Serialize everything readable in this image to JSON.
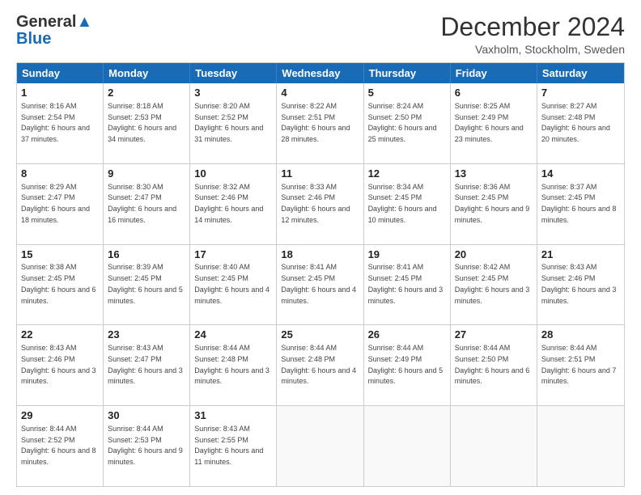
{
  "header": {
    "logo_line1": "General",
    "logo_line2": "Blue",
    "title": "December 2024",
    "subtitle": "Vaxholm, Stockholm, Sweden"
  },
  "days": [
    "Sunday",
    "Monday",
    "Tuesday",
    "Wednesday",
    "Thursday",
    "Friday",
    "Saturday"
  ],
  "weeks": [
    [
      {
        "day": "1",
        "sunrise": "8:16 AM",
        "sunset": "2:54 PM",
        "daylight": "6 hours and 37 minutes."
      },
      {
        "day": "2",
        "sunrise": "8:18 AM",
        "sunset": "2:53 PM",
        "daylight": "6 hours and 34 minutes."
      },
      {
        "day": "3",
        "sunrise": "8:20 AM",
        "sunset": "2:52 PM",
        "daylight": "6 hours and 31 minutes."
      },
      {
        "day": "4",
        "sunrise": "8:22 AM",
        "sunset": "2:51 PM",
        "daylight": "6 hours and 28 minutes."
      },
      {
        "day": "5",
        "sunrise": "8:24 AM",
        "sunset": "2:50 PM",
        "daylight": "6 hours and 25 minutes."
      },
      {
        "day": "6",
        "sunrise": "8:25 AM",
        "sunset": "2:49 PM",
        "daylight": "6 hours and 23 minutes."
      },
      {
        "day": "7",
        "sunrise": "8:27 AM",
        "sunset": "2:48 PM",
        "daylight": "6 hours and 20 minutes."
      }
    ],
    [
      {
        "day": "8",
        "sunrise": "8:29 AM",
        "sunset": "2:47 PM",
        "daylight": "6 hours and 18 minutes."
      },
      {
        "day": "9",
        "sunrise": "8:30 AM",
        "sunset": "2:47 PM",
        "daylight": "6 hours and 16 minutes."
      },
      {
        "day": "10",
        "sunrise": "8:32 AM",
        "sunset": "2:46 PM",
        "daylight": "6 hours and 14 minutes."
      },
      {
        "day": "11",
        "sunrise": "8:33 AM",
        "sunset": "2:46 PM",
        "daylight": "6 hours and 12 minutes."
      },
      {
        "day": "12",
        "sunrise": "8:34 AM",
        "sunset": "2:45 PM",
        "daylight": "6 hours and 10 minutes."
      },
      {
        "day": "13",
        "sunrise": "8:36 AM",
        "sunset": "2:45 PM",
        "daylight": "6 hours and 9 minutes."
      },
      {
        "day": "14",
        "sunrise": "8:37 AM",
        "sunset": "2:45 PM",
        "daylight": "6 hours and 8 minutes."
      }
    ],
    [
      {
        "day": "15",
        "sunrise": "8:38 AM",
        "sunset": "2:45 PM",
        "daylight": "6 hours and 6 minutes."
      },
      {
        "day": "16",
        "sunrise": "8:39 AM",
        "sunset": "2:45 PM",
        "daylight": "6 hours and 5 minutes."
      },
      {
        "day": "17",
        "sunrise": "8:40 AM",
        "sunset": "2:45 PM",
        "daylight": "6 hours and 4 minutes."
      },
      {
        "day": "18",
        "sunrise": "8:41 AM",
        "sunset": "2:45 PM",
        "daylight": "6 hours and 4 minutes."
      },
      {
        "day": "19",
        "sunrise": "8:41 AM",
        "sunset": "2:45 PM",
        "daylight": "6 hours and 3 minutes."
      },
      {
        "day": "20",
        "sunrise": "8:42 AM",
        "sunset": "2:45 PM",
        "daylight": "6 hours and 3 minutes."
      },
      {
        "day": "21",
        "sunrise": "8:43 AM",
        "sunset": "2:46 PM",
        "daylight": "6 hours and 3 minutes."
      }
    ],
    [
      {
        "day": "22",
        "sunrise": "8:43 AM",
        "sunset": "2:46 PM",
        "daylight": "6 hours and 3 minutes."
      },
      {
        "day": "23",
        "sunrise": "8:43 AM",
        "sunset": "2:47 PM",
        "daylight": "6 hours and 3 minutes."
      },
      {
        "day": "24",
        "sunrise": "8:44 AM",
        "sunset": "2:48 PM",
        "daylight": "6 hours and 3 minutes."
      },
      {
        "day": "25",
        "sunrise": "8:44 AM",
        "sunset": "2:48 PM",
        "daylight": "6 hours and 4 minutes."
      },
      {
        "day": "26",
        "sunrise": "8:44 AM",
        "sunset": "2:49 PM",
        "daylight": "6 hours and 5 minutes."
      },
      {
        "day": "27",
        "sunrise": "8:44 AM",
        "sunset": "2:50 PM",
        "daylight": "6 hours and 6 minutes."
      },
      {
        "day": "28",
        "sunrise": "8:44 AM",
        "sunset": "2:51 PM",
        "daylight": "6 hours and 7 minutes."
      }
    ],
    [
      {
        "day": "29",
        "sunrise": "8:44 AM",
        "sunset": "2:52 PM",
        "daylight": "6 hours and 8 minutes."
      },
      {
        "day": "30",
        "sunrise": "8:44 AM",
        "sunset": "2:53 PM",
        "daylight": "6 hours and 9 minutes."
      },
      {
        "day": "31",
        "sunrise": "8:43 AM",
        "sunset": "2:55 PM",
        "daylight": "6 hours and 11 minutes."
      },
      null,
      null,
      null,
      null
    ]
  ]
}
